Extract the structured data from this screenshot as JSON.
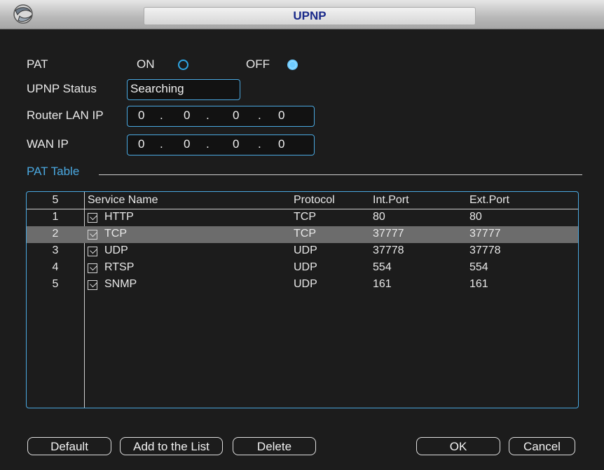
{
  "window": {
    "title": "UPNP"
  },
  "form": {
    "pat_label": "PAT",
    "on_label": "ON",
    "off_label": "OFF",
    "pat_value": "OFF",
    "upnp_status_label": "UPNP Status",
    "upnp_status_value": "Searching",
    "router_lan_ip_label": "Router LAN IP",
    "router_lan_ip": [
      "0",
      "0",
      "0",
      "0"
    ],
    "wan_ip_label": "WAN IP",
    "wan_ip": [
      "0",
      "0",
      "0",
      "0"
    ]
  },
  "pat_table": {
    "section_label": "PAT Table",
    "row_count": "5",
    "headers": {
      "service": "Service Name",
      "protocol": "Protocol",
      "int_port": "Int.Port",
      "ext_port": "Ext.Port"
    },
    "rows": [
      {
        "num": "1",
        "checked": true,
        "service": "HTTP",
        "protocol": "TCP",
        "int_port": "80",
        "ext_port": "80"
      },
      {
        "num": "2",
        "checked": true,
        "service": "TCP",
        "protocol": "TCP",
        "int_port": "37777",
        "ext_port": "37777"
      },
      {
        "num": "3",
        "checked": true,
        "service": "UDP",
        "protocol": "UDP",
        "int_port": "37778",
        "ext_port": "37778"
      },
      {
        "num": "4",
        "checked": true,
        "service": "RTSP",
        "protocol": "UDP",
        "int_port": "554",
        "ext_port": "554"
      },
      {
        "num": "5",
        "checked": true,
        "service": "SNMP",
        "protocol": "UDP",
        "int_port": "161",
        "ext_port": "161"
      }
    ],
    "selected_row": "2"
  },
  "buttons": {
    "default": "Default",
    "add": "Add to the List",
    "delete": "Delete",
    "ok": "OK",
    "cancel": "Cancel"
  },
  "colors": {
    "accent": "#4aa8e0",
    "title_text": "#1a2a8a",
    "section_label": "#4aa8e0",
    "selected_row": "#6c6c6c"
  },
  "icons": {
    "logo": "app-logo-icon",
    "checkbox": "checkbox-checked-icon"
  }
}
